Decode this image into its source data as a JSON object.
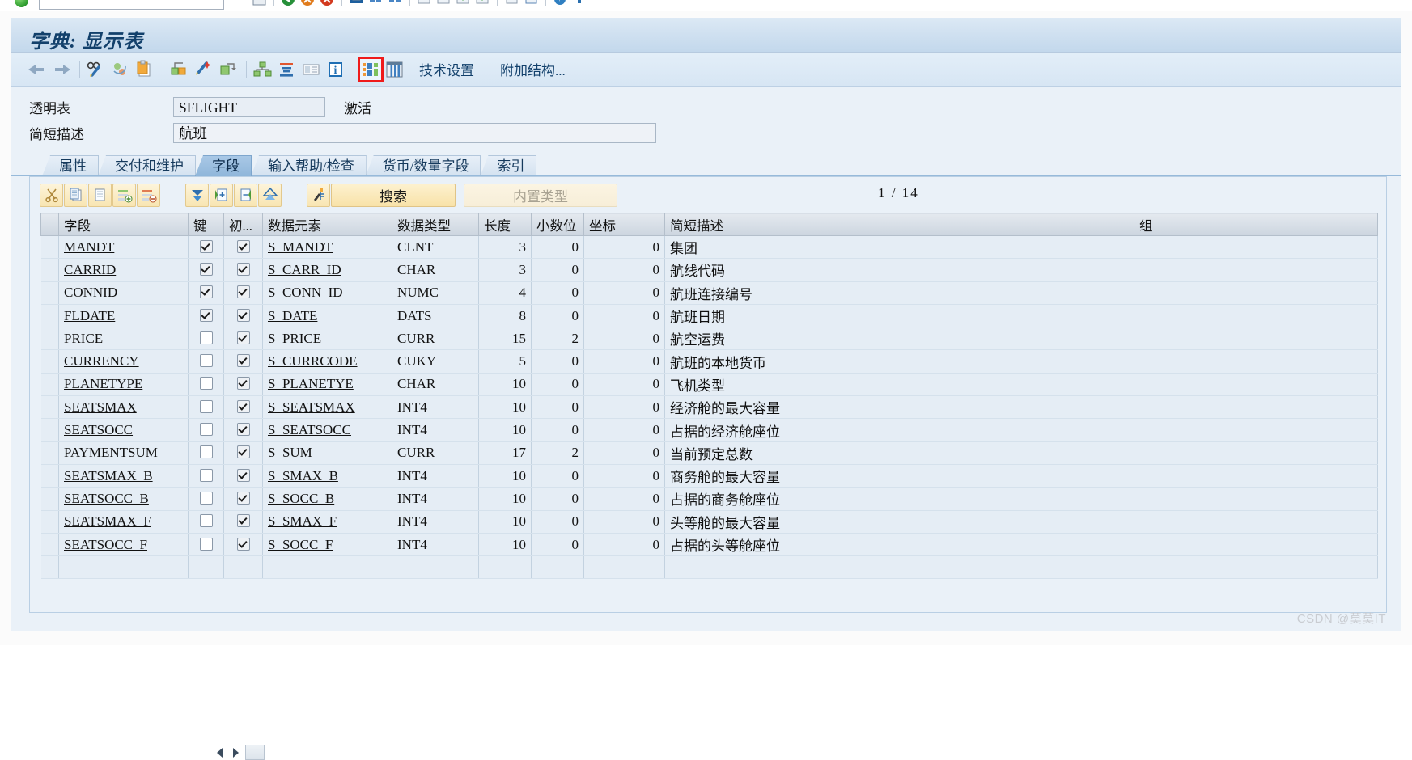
{
  "window": {
    "title": "字典: 显示表"
  },
  "system_toolbar": {
    "command_field_value": "",
    "icons": [
      "save-icon",
      "back-icon",
      "exit-icon",
      "cancel-icon",
      "print-icon",
      "find-icon",
      "find-next-icon",
      "first-page-icon",
      "previous-page-icon",
      "next-page-icon",
      "last-page-icon",
      "create-session-icon",
      "create-shortcut-icon",
      "help-icon",
      "customize-icon"
    ]
  },
  "app_toolbar": {
    "buttons": [
      {
        "name": "back-arrow-icon",
        "label": ""
      },
      {
        "name": "forward-arrow-icon",
        "label": ""
      },
      {
        "name": "display-change-icon",
        "label": ""
      },
      {
        "name": "refresh-icon",
        "label": ""
      },
      {
        "name": "copy-object-icon",
        "label": ""
      },
      {
        "name": "active-inactive-icon",
        "label": ""
      },
      {
        "name": "runtime-object-icon",
        "label": ""
      },
      {
        "name": "where-used-list-icon",
        "label": ""
      },
      {
        "name": "hierarchy-icon",
        "label": ""
      },
      {
        "name": "append-structure-icon",
        "label": ""
      },
      {
        "name": "documentation-icon",
        "label": ""
      },
      {
        "name": "information-icon",
        "label": ""
      },
      {
        "name": "predefined-type-icon",
        "label": ""
      },
      {
        "name": "table-contents-icon",
        "label": ""
      }
    ],
    "highlighted_button_index": 12,
    "text_buttons": [
      "技术设置",
      "附加结构..."
    ]
  },
  "form": {
    "rows": [
      {
        "label": "透明表",
        "value": "SFLIGHT",
        "status": "激活"
      },
      {
        "label": "简短描述",
        "value": "航班",
        "status": ""
      }
    ]
  },
  "tabs": [
    {
      "label": "属性",
      "active": false
    },
    {
      "label": "交付和维护",
      "active": false
    },
    {
      "label": "字段",
      "active": true
    },
    {
      "label": "输入帮助/检查",
      "active": false
    },
    {
      "label": "货币/数量字段",
      "active": false
    },
    {
      "label": "索引",
      "active": false
    }
  ],
  "grid_toolbar": {
    "icon_buttons": [
      {
        "name": "cut-icon"
      },
      {
        "name": "copy-icon"
      },
      {
        "name": "paste-icon"
      },
      {
        "name": "insert-row-icon"
      },
      {
        "name": "delete-row-icon"
      }
    ],
    "icon_buttons_2": [
      {
        "name": "filter-down-icon"
      },
      {
        "name": "expand-column-icon"
      },
      {
        "name": "collapse-column-icon"
      },
      {
        "name": "sort-up-icon"
      }
    ],
    "icon_buttons_3": [
      {
        "name": "srch-key-icon"
      }
    ],
    "search_label": "搜索",
    "builtin_type_label": "内置类型",
    "page_current": "1",
    "page_separator": "/",
    "page_total": "14"
  },
  "table": {
    "columns": [
      "字段",
      "键",
      "初...",
      "数据元素",
      "数据类型",
      "长度",
      "小数位",
      "坐标",
      "简短描述",
      "组"
    ],
    "rows": [
      {
        "field": "MANDT",
        "key": true,
        "init": true,
        "data_element": "S_MANDT",
        "data_type": "CLNT",
        "length": "3",
        "decimals": "0",
        "coord": "0",
        "description": "集团",
        "group": ""
      },
      {
        "field": "CARRID",
        "key": true,
        "init": true,
        "data_element": "S_CARR_ID",
        "data_type": "CHAR",
        "length": "3",
        "decimals": "0",
        "coord": "0",
        "description": "航线代码",
        "group": ""
      },
      {
        "field": "CONNID",
        "key": true,
        "init": true,
        "data_element": "S_CONN_ID",
        "data_type": "NUMC",
        "length": "4",
        "decimals": "0",
        "coord": "0",
        "description": "航班连接编号",
        "group": ""
      },
      {
        "field": "FLDATE",
        "key": true,
        "init": true,
        "data_element": "S_DATE",
        "data_type": "DATS",
        "length": "8",
        "decimals": "0",
        "coord": "0",
        "description": "航班日期",
        "group": ""
      },
      {
        "field": "PRICE",
        "key": false,
        "init": true,
        "data_element": "S_PRICE",
        "data_type": "CURR",
        "length": "15",
        "decimals": "2",
        "coord": "0",
        "description": "航空运费",
        "group": ""
      },
      {
        "field": "CURRENCY",
        "key": false,
        "init": true,
        "data_element": "S_CURRCODE",
        "data_type": "CUKY",
        "length": "5",
        "decimals": "0",
        "coord": "0",
        "description": "航班的本地货币",
        "group": ""
      },
      {
        "field": "PLANETYPE",
        "key": false,
        "init": true,
        "data_element": "S_PLANETYE",
        "data_type": "CHAR",
        "length": "10",
        "decimals": "0",
        "coord": "0",
        "description": "飞机类型",
        "group": ""
      },
      {
        "field": "SEATSMAX",
        "key": false,
        "init": true,
        "data_element": "S_SEATSMAX",
        "data_type": "INT4",
        "length": "10",
        "decimals": "0",
        "coord": "0",
        "description": "经济舱的最大容量",
        "group": ""
      },
      {
        "field": "SEATSOCC",
        "key": false,
        "init": true,
        "data_element": "S_SEATSOCC",
        "data_type": "INT4",
        "length": "10",
        "decimals": "0",
        "coord": "0",
        "description": "占据的经济舱座位",
        "group": ""
      },
      {
        "field": "PAYMENTSUM",
        "key": false,
        "init": true,
        "data_element": "S_SUM",
        "data_type": "CURR",
        "length": "17",
        "decimals": "2",
        "coord": "0",
        "description": "当前预定总数",
        "group": ""
      },
      {
        "field": "SEATSMAX_B",
        "key": false,
        "init": true,
        "data_element": "S_SMAX_B",
        "data_type": "INT4",
        "length": "10",
        "decimals": "0",
        "coord": "0",
        "description": "商务舱的最大容量",
        "group": ""
      },
      {
        "field": "SEATSOCC_B",
        "key": false,
        "init": true,
        "data_element": "S_SOCC_B",
        "data_type": "INT4",
        "length": "10",
        "decimals": "0",
        "coord": "0",
        "description": "占据的商务舱座位",
        "group": ""
      },
      {
        "field": "SEATSMAX_F",
        "key": false,
        "init": true,
        "data_element": "S_SMAX_F",
        "data_type": "INT4",
        "length": "10",
        "decimals": "0",
        "coord": "0",
        "description": "头等舱的最大容量",
        "group": ""
      },
      {
        "field": "SEATSOCC_F",
        "key": false,
        "init": true,
        "data_element": "S_SOCC_F",
        "data_type": "INT4",
        "length": "10",
        "decimals": "0",
        "coord": "0",
        "description": "占据的头等舱座位",
        "group": ""
      },
      {
        "field": "",
        "key": null,
        "init": null,
        "data_element": "",
        "data_type": "",
        "length": "",
        "decimals": "",
        "coord": "",
        "description": "",
        "group": ""
      }
    ]
  },
  "watermark": "CSDN @莫莫IT",
  "colors": {
    "accent": "#12406b",
    "panel_bg": "#eaf1f8",
    "grid_row_bg": "#e5edf5",
    "highlight_outline": "#ef1b1b",
    "tab_active": "#8fb6da",
    "button_yellow": "#f8e2a8"
  }
}
